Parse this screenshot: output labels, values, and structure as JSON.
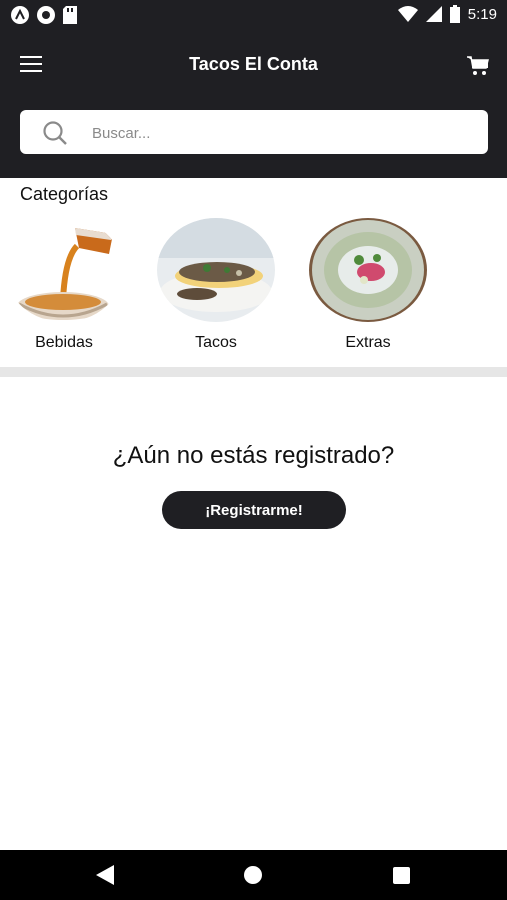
{
  "status_bar": {
    "time": "5:19",
    "left_icons": [
      "app-a-icon",
      "circle-icon",
      "sd-card-icon"
    ],
    "right_icons": [
      "wifi-icon",
      "signal-icon",
      "battery-icon"
    ]
  },
  "app_bar": {
    "title": "Tacos El Conta",
    "menu_icon": "menu-icon",
    "cart_icon": "cart-icon"
  },
  "search": {
    "placeholder": "Buscar..."
  },
  "categories": {
    "title": "Categorías",
    "items": [
      {
        "label": "Bebidas"
      },
      {
        "label": "Tacos"
      },
      {
        "label": "Extras"
      }
    ]
  },
  "register": {
    "question": "¿Aún no estás registrado?",
    "button_label": "¡Registrarme!"
  },
  "nav_bar": {
    "icons": [
      "back-icon",
      "home-icon",
      "recents-icon"
    ]
  },
  "colors": {
    "appbar": "#1f1f23",
    "divider": "#e6e6e6",
    "button": "#1f1f23"
  }
}
